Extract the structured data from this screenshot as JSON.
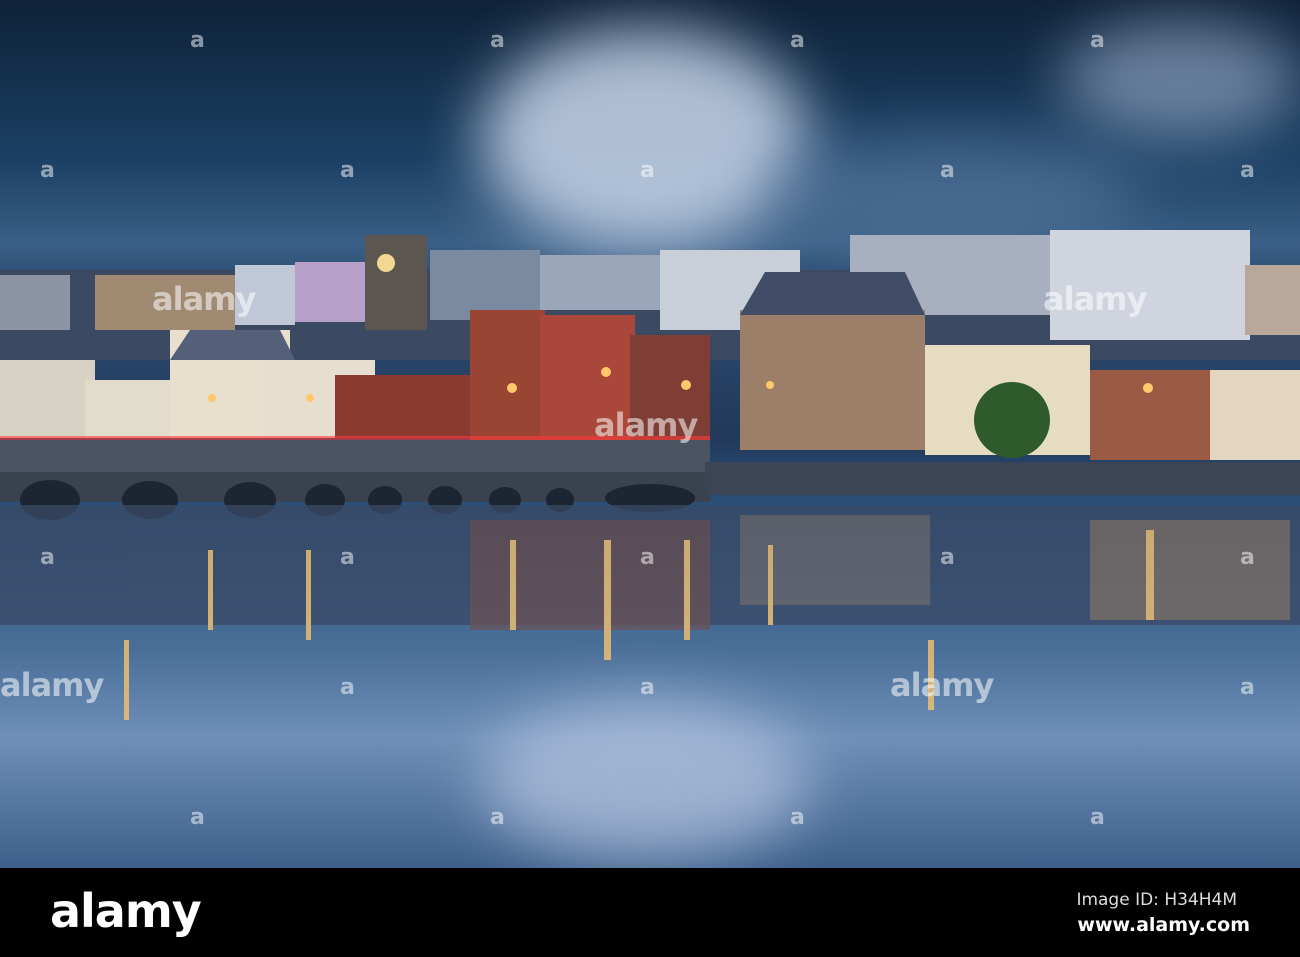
{
  "photo": {
    "subject": "Bideford waterfront town at dusk reflected in river",
    "colors": {
      "sky_dark": "#0e2238",
      "sky_light": "#c9d6ea",
      "lights": "#ffb347",
      "water": "#4a6f99"
    }
  },
  "watermark": {
    "text": "alamy",
    "small_mark": "a"
  },
  "footer": {
    "logo": "alamy",
    "image_id": "Image ID: H34H4M",
    "website": "www.alamy.com"
  }
}
